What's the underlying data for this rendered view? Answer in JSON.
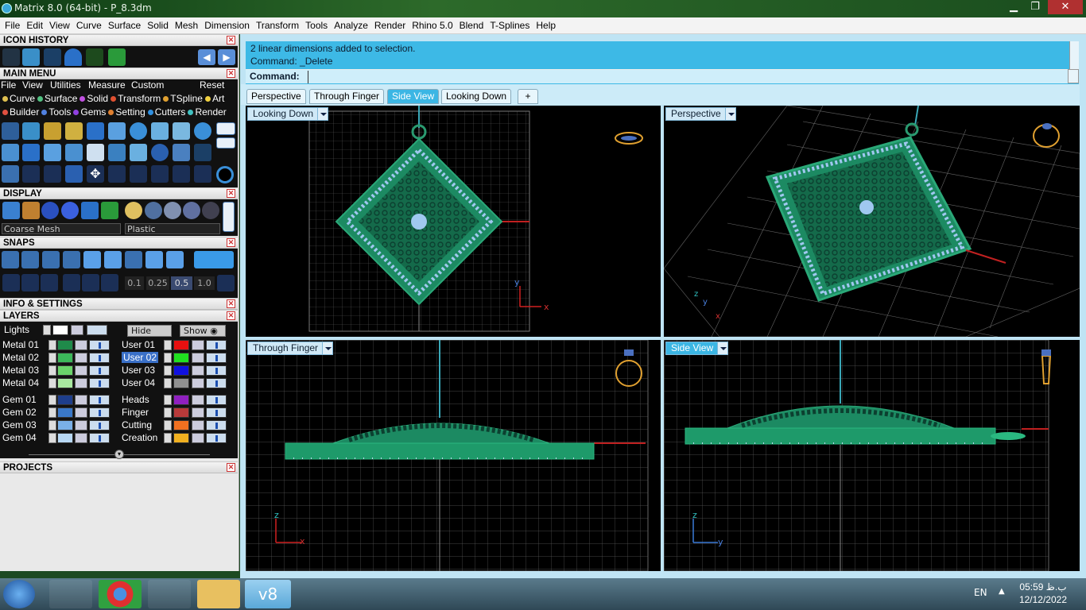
{
  "titlebar": {
    "title": "Matrix 8.0 (64-bit) - P_8.3dm",
    "minimize": "▁",
    "restore": "❐",
    "close": "✕"
  },
  "menubar": [
    "File",
    "Edit",
    "View",
    "Curve",
    "Surface",
    "Solid",
    "Mesh",
    "Dimension",
    "Transform",
    "Tools",
    "Analyze",
    "Render",
    "Rhino 5.0",
    "Blend",
    "T-Splines",
    "Help"
  ],
  "left": {
    "icon_history": "ICON HISTORY",
    "main_menu": "MAIN MENU",
    "main_menu_items": [
      "File",
      "View",
      "Utilities",
      "Measure",
      "Custom"
    ],
    "reset": "Reset",
    "categories1": [
      {
        "label": "Curve",
        "color": "#e0c050"
      },
      {
        "label": "Surface",
        "color": "#50c080"
      },
      {
        "label": "Solid",
        "color": "#c050e0"
      },
      {
        "label": "Transform",
        "color": "#e05030"
      },
      {
        "label": "TSpline",
        "color": "#e0a030"
      },
      {
        "label": "Art",
        "color": "#f0d040"
      }
    ],
    "categories2": [
      {
        "label": "Builder",
        "color": "#e05040"
      },
      {
        "label": "Tools",
        "color": "#5080e0"
      },
      {
        "label": "Gems",
        "color": "#9040e0"
      },
      {
        "label": "Setting",
        "color": "#e08030"
      },
      {
        "label": "Cutters",
        "color": "#3090e0"
      },
      {
        "label": "Render",
        "color": "#40c0c0"
      }
    ],
    "display": "DISPLAY",
    "display_mesh": "Coarse Mesh",
    "display_material": "Plastic",
    "snaps": "SNAPS",
    "snap_values": [
      "0.1",
      "0.25",
      "0.5",
      "1.0"
    ],
    "info_settings": "INFO & SETTINGS",
    "layers": "LAYERS",
    "lights": "Lights",
    "hide": "Hide",
    "show": "Show",
    "layers_left": [
      {
        "name": "Metal 01",
        "color": "#1f8a4a"
      },
      {
        "name": "Metal 02",
        "color": "#3cb85a"
      },
      {
        "name": "Metal 03",
        "color": "#6ad46a"
      },
      {
        "name": "Metal 04",
        "color": "#a8e8a0"
      },
      {
        "name": "Gem 01",
        "color": "#1e3e8c"
      },
      {
        "name": "Gem 02",
        "color": "#3a78c8"
      },
      {
        "name": "Gem 03",
        "color": "#7ab0e8"
      },
      {
        "name": "Gem 04",
        "color": "#b8d8f4"
      }
    ],
    "layers_right": [
      {
        "name": "User 01",
        "color": "#e81010"
      },
      {
        "name": "User 02",
        "color": "#20e020"
      },
      {
        "name": "User 03",
        "color": "#1010e0"
      },
      {
        "name": "User 04",
        "color": "#909090"
      },
      {
        "name": "Heads",
        "color": "#9020c0"
      },
      {
        "name": "Finger",
        "color": "#b83a3a"
      },
      {
        "name": "Cutting",
        "color": "#f07020"
      },
      {
        "name": "Creation",
        "color": "#f0b020"
      }
    ],
    "projects": "PROJECTS"
  },
  "command": {
    "line1": "2 linear dimensions added to selection.",
    "line2": "Command: _Delete",
    "prompt": "Command:"
  },
  "tabs": [
    "Perspective",
    "Through Finger",
    "Side View",
    "Looking Down",
    "+"
  ],
  "viewports": {
    "top_left": "Looking Down",
    "top_right": "Perspective",
    "bottom_left": "Through Finger",
    "bottom_right": "Side View"
  },
  "axes": {
    "y": "y",
    "x": "x",
    "z": "z"
  },
  "taskbar": {
    "lang": "EN",
    "time": "05:59 ب.ظ",
    "date": "12/12/2022",
    "v8": "v8"
  }
}
